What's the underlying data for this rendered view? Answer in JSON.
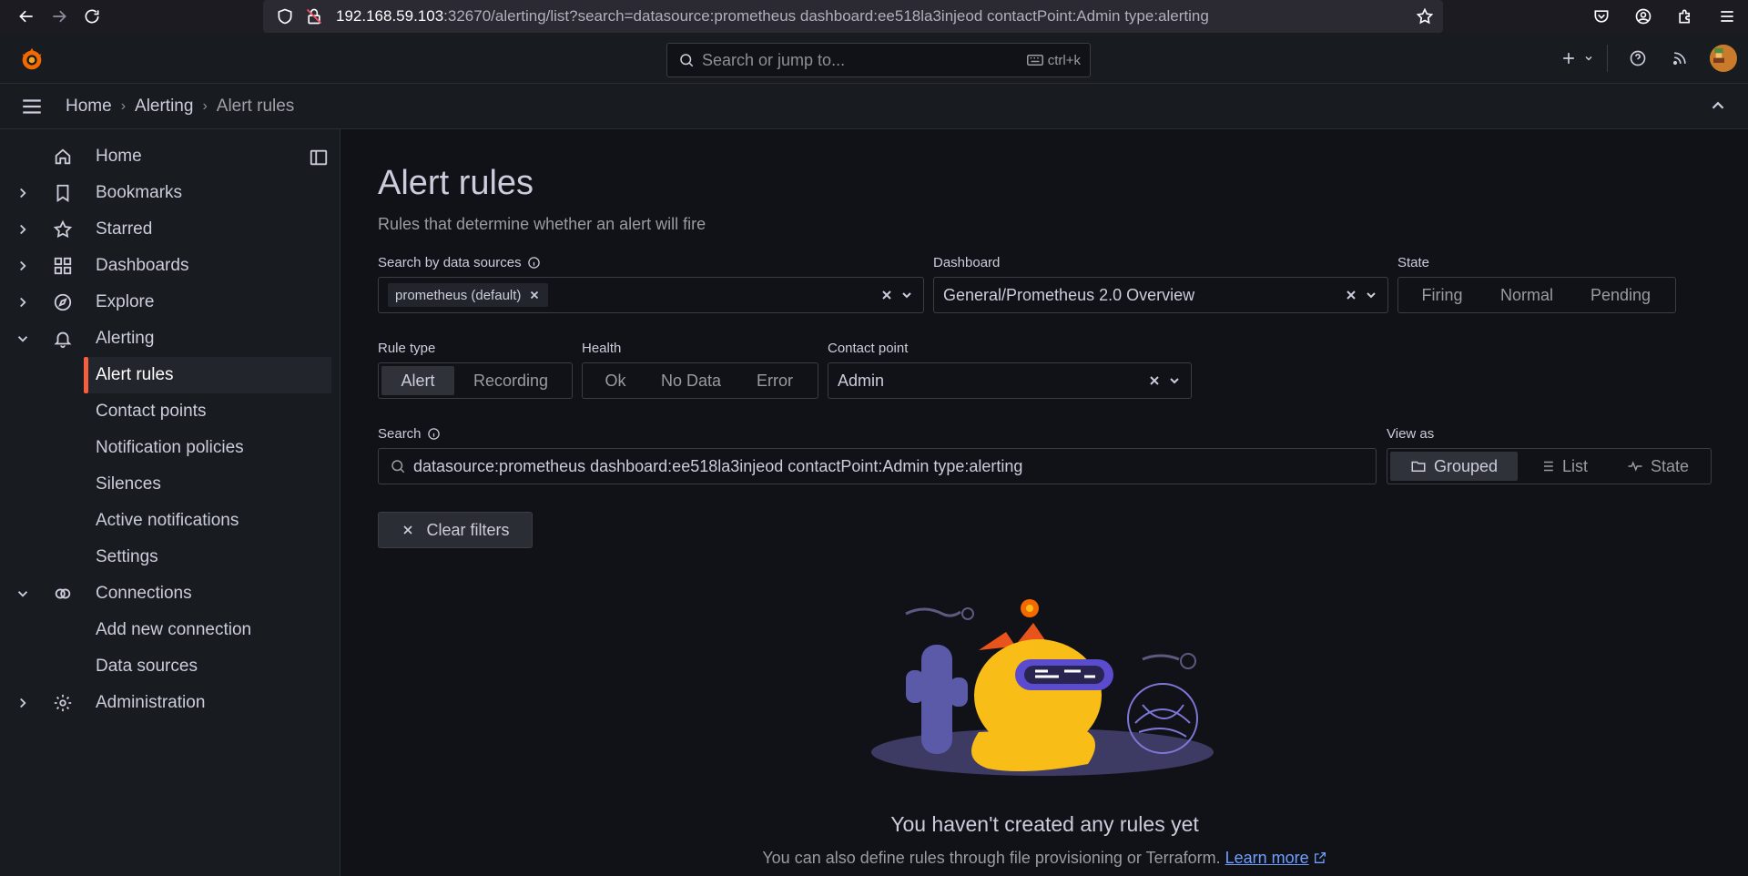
{
  "browser": {
    "url_host": "192.168.59.103",
    "url_rest": ":32670/alerting/list?search=datasource:prometheus dashboard:ee518la3injeod contactPoint:Admin type:alerting"
  },
  "topbar": {
    "search_placeholder": "Search or jump to...",
    "shortcut": "ctrl+k"
  },
  "breadcrumbs": [
    "Home",
    "Alerting",
    "Alert rules"
  ],
  "sidebar": {
    "items": [
      {
        "label": "Home",
        "icon": "home-icon"
      },
      {
        "label": "Bookmarks",
        "icon": "bookmark-icon"
      },
      {
        "label": "Starred",
        "icon": "star-icon"
      },
      {
        "label": "Dashboards",
        "icon": "apps-icon"
      },
      {
        "label": "Explore",
        "icon": "compass-icon"
      },
      {
        "label": "Alerting",
        "icon": "bell-icon"
      },
      {
        "label": "Alert rules"
      },
      {
        "label": "Contact points"
      },
      {
        "label": "Notification policies"
      },
      {
        "label": "Silences"
      },
      {
        "label": "Active notifications"
      },
      {
        "label": "Settings"
      },
      {
        "label": "Connections",
        "icon": "connections-icon"
      },
      {
        "label": "Add new connection"
      },
      {
        "label": "Data sources"
      },
      {
        "label": "Administration",
        "icon": "cog-icon"
      }
    ]
  },
  "page": {
    "title": "Alert rules",
    "subtitle": "Rules that determine whether an alert will fire"
  },
  "filters": {
    "datasource_label": "Search by data sources",
    "datasource_chip": "prometheus (default)",
    "dashboard_label": "Dashboard",
    "dashboard_value": "General/Prometheus 2.0 Overview",
    "state_label": "State",
    "state_options": [
      "Firing",
      "Normal",
      "Pending"
    ],
    "rule_type_label": "Rule type",
    "rule_type_options": [
      "Alert",
      "Recording"
    ],
    "rule_type_selected": "Alert",
    "health_label": "Health",
    "health_options": [
      "Ok",
      "No Data",
      "Error"
    ],
    "contact_label": "Contact point",
    "contact_value": "Admin",
    "search_label": "Search",
    "search_value": "datasource:prometheus dashboard:ee518la3injeod contactPoint:Admin type:alerting",
    "view_label": "View as",
    "view_options": [
      "Grouped",
      "List",
      "State"
    ],
    "view_selected": "Grouped",
    "clear_label": "Clear filters"
  },
  "empty": {
    "title": "You haven't created any rules yet",
    "subtitle": "You can also define rules through file provisioning or Terraform.",
    "link": "Learn more"
  },
  "colors": {
    "accent": "#f55f3e",
    "link": "#6e9fff",
    "background": "#111217",
    "panel": "#181b1f"
  }
}
